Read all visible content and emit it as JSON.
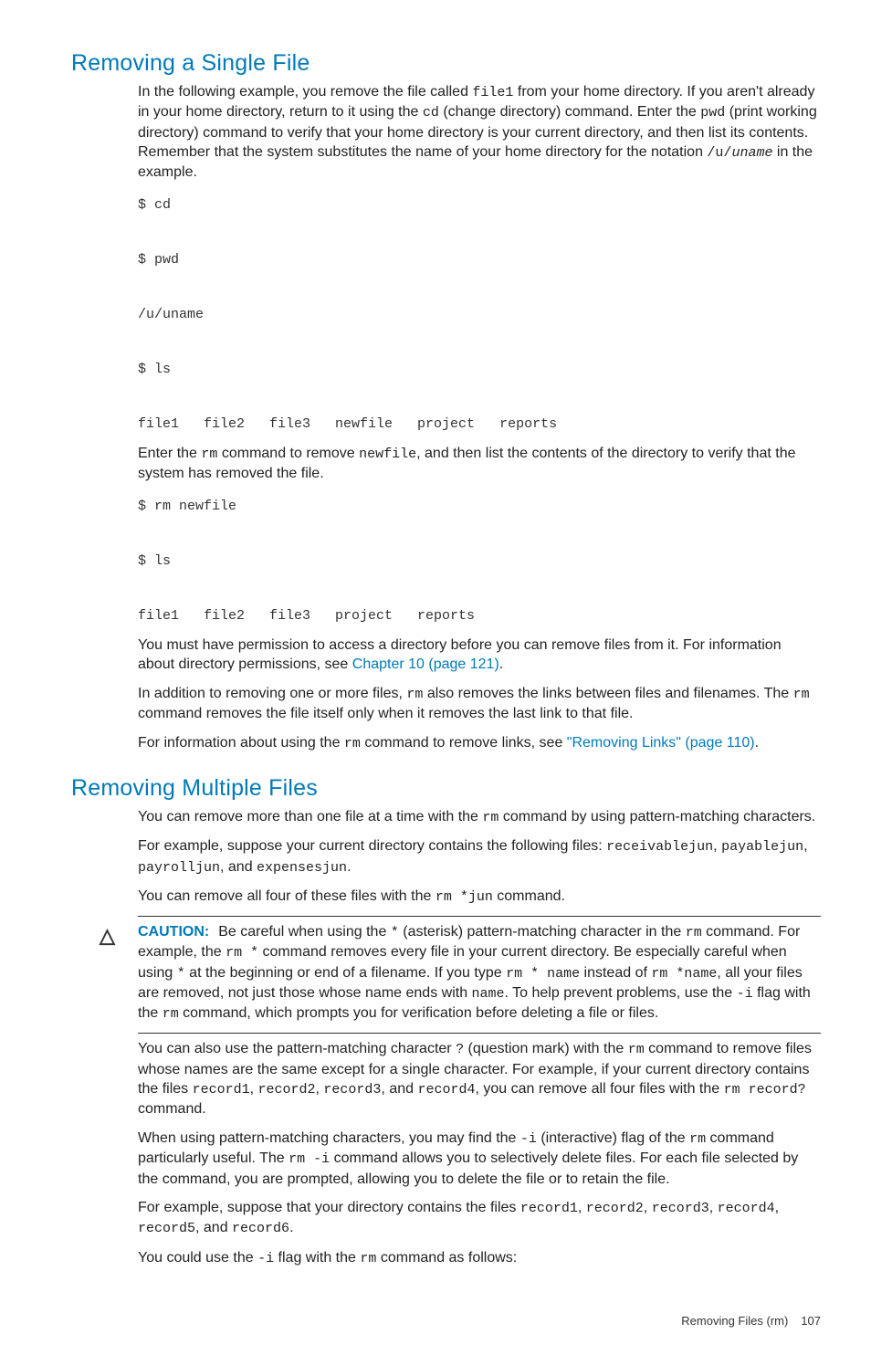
{
  "s1": {
    "title": "Removing a Single File",
    "p1a": "In the following example, you remove the file called ",
    "p1_code1": "file1",
    "p1b": " from your home directory. If you aren't already in your home directory, return to it using the ",
    "p1_code2": "cd",
    "p1c": " (change directory) command. Enter the ",
    "p1_code3": "pwd",
    "p1d": " (print working directory) command to verify that your home directory is your current directory, and then list its contents. Remember that the system substitutes the name of your home directory for the notation ",
    "p1_code4": "/u/",
    "p1_code5": "uname",
    "p1e": " in the example.",
    "code1": "$ cd\n\n$ pwd\n\n/u/uname\n\n$ ls\n\nfile1   file2   file3   newfile   project   reports",
    "p2a": "Enter the ",
    "p2_code1": "rm",
    "p2b": " command to remove ",
    "p2_code2": "newfile",
    "p2c": ", and then list the contents of the directory to verify that the system has removed the file.",
    "code2": "$ rm newfile\n\n$ ls\n\nfile1   file2   file3   project   reports",
    "p3a": "You must have permission to access a directory before you can remove files from it. For information about directory permissions, see ",
    "p3_link": "Chapter 10 (page 121)",
    "p3b": ".",
    "p4a": "In addition to removing one or more files, ",
    "p4_code1": "rm",
    "p4b": " also removes the links between files and filenames. The ",
    "p4_code2": "rm",
    "p4c": " command removes the file itself only when it removes the last link to that file.",
    "p5a": "For information about using the ",
    "p5_code1": "rm",
    "p5b": " command to remove links, see ",
    "p5_link": "\"Removing Links\" (page 110)",
    "p5c": "."
  },
  "s2": {
    "title": "Removing Multiple Files",
    "p1a": "You can remove more than one file at a time with the ",
    "p1_code1": "rm",
    "p1b": " command by using pattern-matching characters.",
    "p2a": "For example, suppose your current directory contains the following files: ",
    "p2_code1": "receivablejun",
    "p2b": ", ",
    "p2_code2": "payablejun",
    "p2c": ", ",
    "p2_code3": "payrolljun",
    "p2d": ", and ",
    "p2_code4": "expensesjun",
    "p2e": ".",
    "p3a": "You can remove all four of these files with the ",
    "p3_code1": " rm *jun",
    "p3b": " command.",
    "caution_label": "CAUTION:",
    "ca": "Be careful when using the ",
    "c_code1": "*",
    "cb": " (asterisk) pattern-matching character in the ",
    "c_code2": "rm",
    "cc": " command. For example, the ",
    "c_code3": "rm *",
    "cd": " command removes every file in your current directory. Be especially careful when using ",
    "c_code4": "*",
    "ce": " at the beginning or end of a filename. If you type ",
    "c_code5": "rm * name",
    "cf": " instead of ",
    "c_code6": " rm *name",
    "cg": ", all your files are removed, not just those whose name ends with ",
    "c_code7": "name",
    "ch": ". To help prevent problems, use the ",
    "c_code8": "-i",
    "ci": " flag with the ",
    "c_code9": "rm",
    "cj": " command, which prompts you for verification before deleting a file or files.",
    "p4a": "You can also use the pattern-matching character ",
    "p4_code1": "?",
    "p4b": " (question mark) with the ",
    "p4_code2": "rm",
    "p4c": " command to remove files whose names are the same except for a single character. For example, if your current directory contains the files ",
    "p4_code3": "record1",
    "p4d": ", ",
    "p4_code4": "record2",
    "p4e": ", ",
    "p4_code5": "record3",
    "p4f": ", and ",
    "p4_code6": "record4",
    "p4g": ", you can remove all four files with the ",
    "p4_code7": "rm record?",
    "p4h": "  command.",
    "p5a": "When using pattern-matching characters, you may find the ",
    "p5_code1": "-i",
    "p5b": " (interactive) flag of the ",
    "p5_code2": "rm",
    "p5c": " command particularly useful. The ",
    "p5_code3": "rm -i",
    "p5d": " command allows you to selectively delete files. For each file selected by the command, you are prompted, allowing you to delete the file or to retain the file.",
    "p6a": "For example, suppose that your directory contains the files ",
    "p6_code1": "record1",
    "p6b": ", ",
    "p6_code2": "record2",
    "p6c": ", ",
    "p6_code3": "record3",
    "p6d": ", ",
    "p6_code4": "record4",
    "p6e": ", ",
    "p6_code5": "record5",
    "p6f": ", and ",
    "p6_code6": "record6",
    "p6g": ".",
    "p7a": "You could use the ",
    "p7_code1": "-i",
    "p7b": " flag with the ",
    "p7_code2": "rm",
    "p7c": " command as follows:"
  },
  "footer": {
    "text": "Removing Files (rm)",
    "page": "107"
  },
  "triangle": "△"
}
